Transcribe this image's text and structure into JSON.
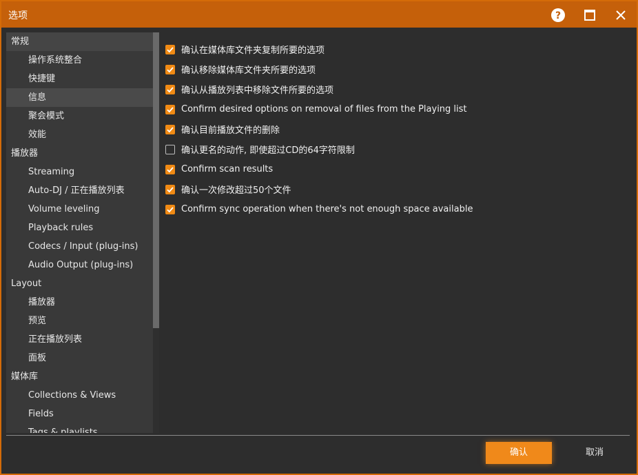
{
  "window": {
    "title": "选项"
  },
  "sidebar": {
    "items": [
      {
        "label": "常规",
        "level": "category",
        "active": false,
        "highlight": true
      },
      {
        "label": "操作系统整合",
        "level": "sub"
      },
      {
        "label": "快捷键",
        "level": "sub"
      },
      {
        "label": "信息",
        "level": "sub",
        "active": true
      },
      {
        "label": "聚会模式",
        "level": "sub"
      },
      {
        "label": "效能",
        "level": "sub"
      },
      {
        "label": "播放器",
        "level": "category"
      },
      {
        "label": "Streaming",
        "level": "sub"
      },
      {
        "label": "Auto-DJ / 正在播放列表",
        "level": "sub"
      },
      {
        "label": "Volume leveling",
        "level": "sub"
      },
      {
        "label": "Playback rules",
        "level": "sub"
      },
      {
        "label": "Codecs / Input (plug-ins)",
        "level": "sub"
      },
      {
        "label": "Audio Output (plug-ins)",
        "level": "sub"
      },
      {
        "label": "Layout",
        "level": "category"
      },
      {
        "label": "播放器",
        "level": "sub"
      },
      {
        "label": "预览",
        "level": "sub"
      },
      {
        "label": "正在播放列表",
        "level": "sub"
      },
      {
        "label": "面板",
        "level": "sub"
      },
      {
        "label": "媒体库",
        "level": "category"
      },
      {
        "label": "Collections & Views",
        "level": "sub"
      },
      {
        "label": "Fields",
        "level": "sub"
      },
      {
        "label": "Tags & playlists",
        "level": "sub"
      }
    ]
  },
  "options": [
    {
      "label": "确认在媒体库文件夹复制所要的选项",
      "checked": true
    },
    {
      "label": "确认移除媒体库文件夹所要的选项",
      "checked": true
    },
    {
      "label": "确认从播放列表中移除文件所要的选项",
      "checked": true
    },
    {
      "label": "Confirm desired options on removal of files from the Playing list",
      "checked": true
    },
    {
      "label": "确认目前播放文件的删除",
      "checked": true
    },
    {
      "label": "确认更名的动作, 即使超过CD的64字符限制",
      "checked": false
    },
    {
      "label": "Confirm scan results",
      "checked": true
    },
    {
      "label": "确认一次修改超过50个文件",
      "checked": true
    },
    {
      "label": "Confirm sync operation when there's not enough space available",
      "checked": true
    }
  ],
  "buttons": {
    "ok": "确认",
    "cancel": "取消"
  },
  "colors": {
    "accent": "#f08a14",
    "titlebar": "#c5600a"
  }
}
